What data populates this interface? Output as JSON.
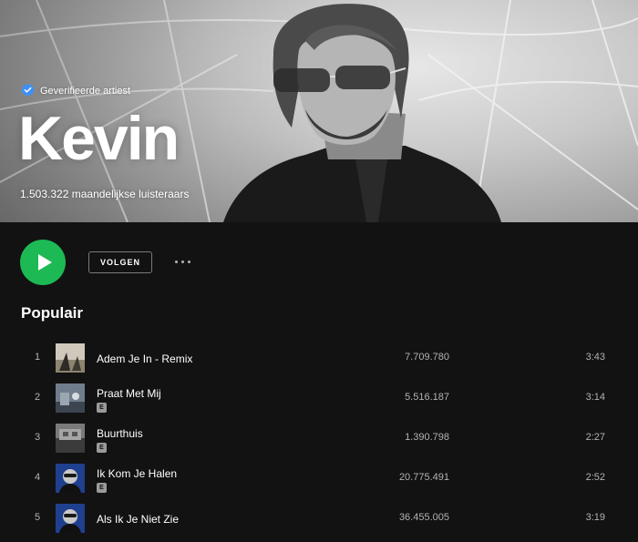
{
  "artist": {
    "verified_label": "Geverifieerde artiest",
    "name": "Kevin",
    "monthly_listeners": "1.503.322 maandelijkse luisteraars"
  },
  "actions": {
    "follow_label": "VOLGEN"
  },
  "popular": {
    "title": "Populair",
    "tracks": [
      {
        "number": "1",
        "title": "Adem Je In - Remix",
        "explicit": "",
        "plays": "7.709.780",
        "duration": "3:43"
      },
      {
        "number": "2",
        "title": "Praat Met Mij",
        "explicit": "E",
        "plays": "5.516.187",
        "duration": "3:14"
      },
      {
        "number": "3",
        "title": "Buurthuis",
        "explicit": "E",
        "plays": "1.390.798",
        "duration": "2:27"
      },
      {
        "number": "4",
        "title": "Ik Kom Je Halen",
        "explicit": "E",
        "plays": "20.775.491",
        "duration": "2:52"
      },
      {
        "number": "5",
        "title": "Als Ik Je Niet Zie",
        "explicit": "",
        "plays": "36.455.005",
        "duration": "3:19"
      }
    ]
  },
  "colors": {
    "accent": "#1db954",
    "background": "#121212",
    "verified_badge": "#3d91f4"
  },
  "icons": {
    "verified": "verified-badge-icon",
    "play": "play-icon",
    "more": "more-options-icon"
  }
}
